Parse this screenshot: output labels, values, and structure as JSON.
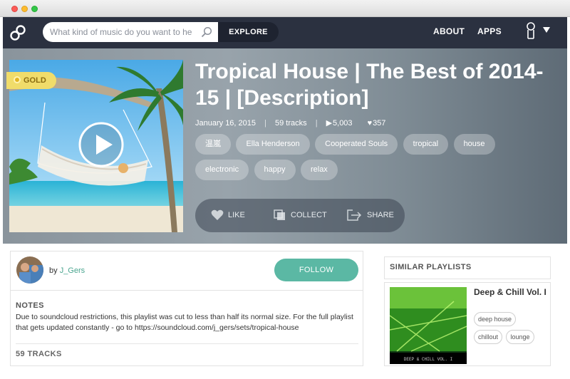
{
  "window": {
    "controls": [
      "close",
      "minimize",
      "maximize"
    ]
  },
  "nav": {
    "logo": "8tracks-logo",
    "search_placeholder": "What kind of music do you want to hear?",
    "explore_label": "EXPLORE",
    "about_label": "ABOUT",
    "apps_label": "APPS"
  },
  "playlist": {
    "badge": "GOLD",
    "title": "Tropical House | The Best of 2014-15 | [Description]",
    "date": "January 16, 2015",
    "separator": "|",
    "tracks": "59 tracks",
    "plays": "5,003",
    "likes": "357",
    "tags": [
      "温嵐",
      "Ella Henderson",
      "Cooperated Souls",
      "tropical",
      "house",
      "electronic",
      "happy",
      "relax"
    ],
    "actions": {
      "like": "LIKE",
      "collect": "COLLECT",
      "share": "SHARE"
    }
  },
  "owner": {
    "by_label": "by",
    "username": "J_Gers",
    "follow_label": "FOLLOW"
  },
  "notes": {
    "title": "NOTES",
    "text": "Due to soundcloud restrictions, this playlist was cut to less than half its normal size. For the full playlist that gets updated constantly - go to https://soundcloud.com/j_gers/sets/tropical-house",
    "track_count_label": "59 TRACKS"
  },
  "similar": {
    "heading": "SIMILAR PLAYLISTS",
    "items": [
      {
        "title": "Deep & Chill Vol. I",
        "cover_text": "DEEP & CHILL VOL. I",
        "tags": [
          "deep house",
          "chillout",
          "lounge"
        ]
      }
    ]
  },
  "colors": {
    "nav": "#2b3140",
    "accent": "#5bb8a4",
    "badge": "#f0dc6a"
  }
}
